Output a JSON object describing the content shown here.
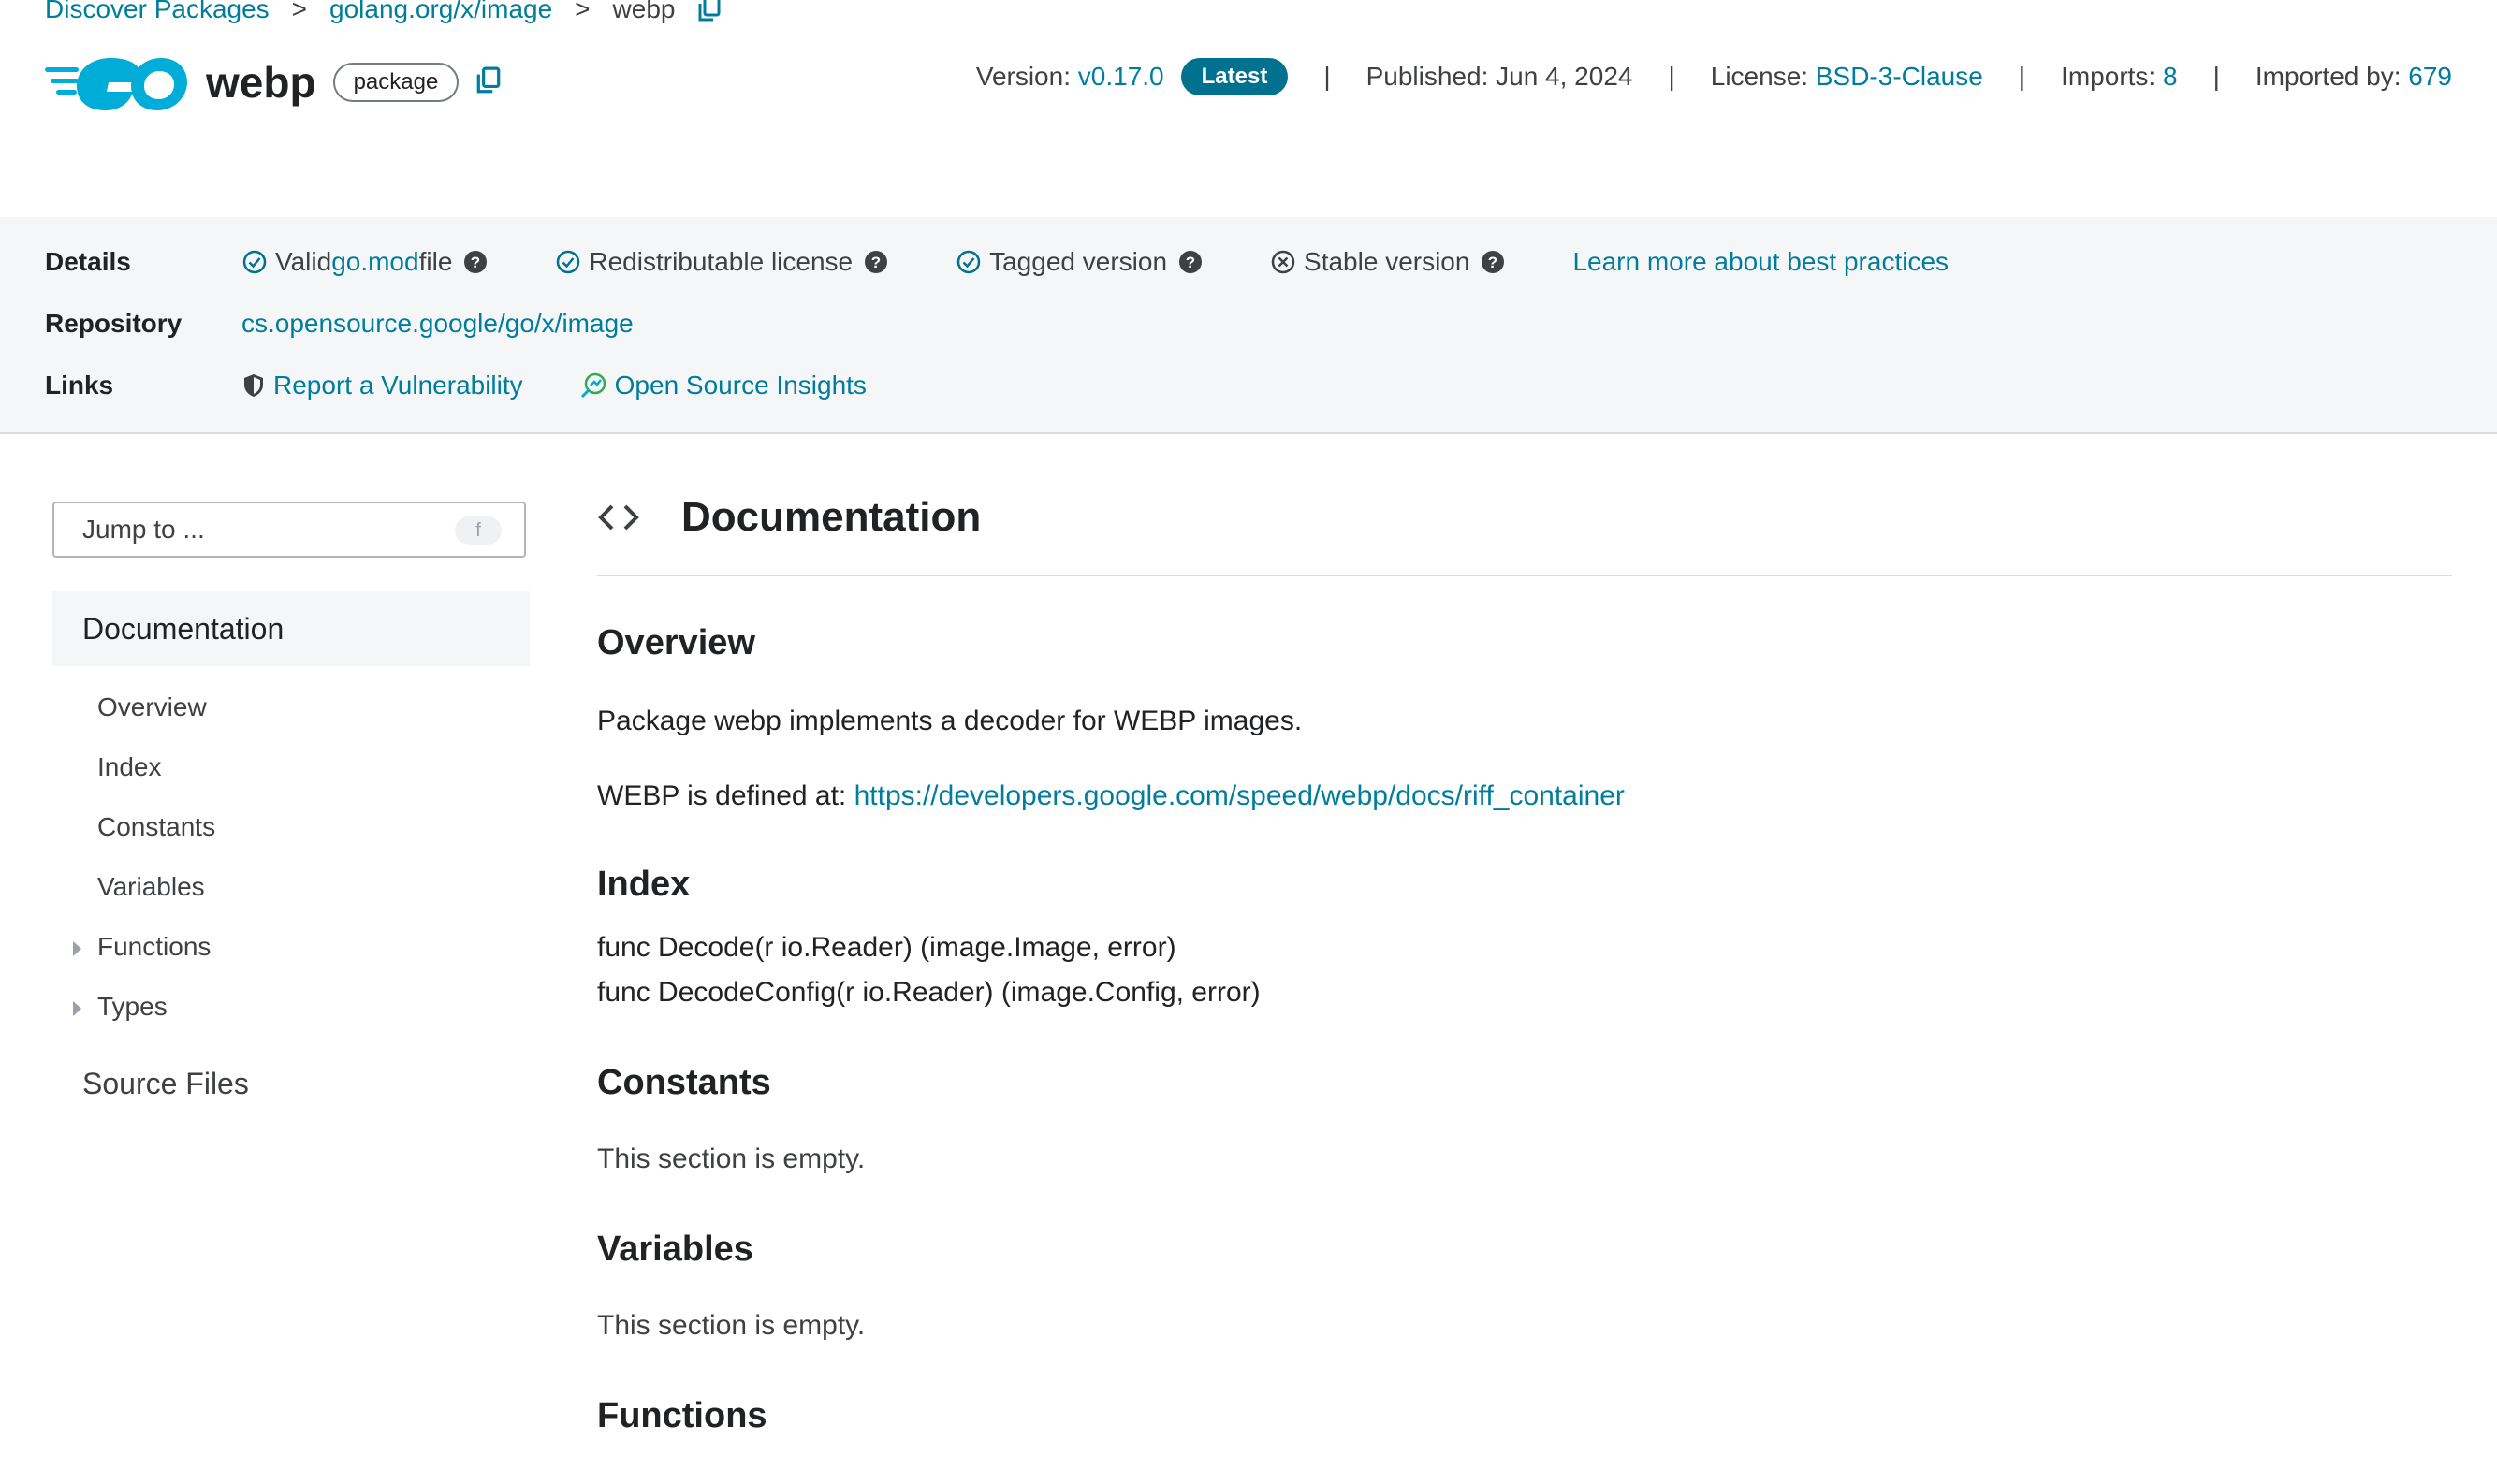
{
  "breadcrumb": {
    "items": [
      "Discover Packages",
      "golang.org/x/image",
      "webp"
    ],
    "separator": ">"
  },
  "header": {
    "logo": "go-logo",
    "title": "webp",
    "badge": "package",
    "version_label": "Version:",
    "version_value": "v0.17.0",
    "latest_label": "Latest",
    "published": "Published: Jun 4, 2024",
    "license_label": "License:",
    "license_value": "BSD-3-Clause",
    "imports_label": "Imports:",
    "imports_value": "8",
    "imported_by_label": "Imported by:",
    "imported_by_value": "679",
    "divider": "|"
  },
  "details": {
    "details_label": "Details",
    "checks": [
      {
        "pre": "Valid ",
        "link": "go.mod",
        "post": " file",
        "status": "valid"
      },
      {
        "pre": "Redistributable license",
        "status": "valid"
      },
      {
        "pre": "Tagged version",
        "status": "valid"
      },
      {
        "pre": "Stable version",
        "status": "invalid"
      }
    ],
    "learn_more": "Learn more about best practices",
    "repository_label": "Repository",
    "repository_value": "cs.opensource.google/go/x/image",
    "links_label": "Links",
    "link_vuln": "Report a Vulnerability",
    "link_insights": "Open Source Insights"
  },
  "sidebar": {
    "jump_placeholder": "Jump to ...",
    "jump_key": "f",
    "documentation": "Documentation",
    "items": [
      "Overview",
      "Index",
      "Constants",
      "Variables",
      "Functions",
      "Types"
    ],
    "source_files": "Source Files"
  },
  "main": {
    "heading": "Documentation",
    "overview_title": "Overview",
    "overview_text": "Package webp implements a decoder for WEBP images.",
    "defined_prefix": "WEBP is defined at: ",
    "defined_link": "https://developers.google.com/speed/webp/docs/riff_container",
    "index_title": "Index",
    "index_items": [
      "func Decode(r io.Reader) (image.Image, error)",
      "func DecodeConfig(r io.Reader) (image.Config, error)"
    ],
    "constants_title": "Constants",
    "constants_text": "This section is empty.",
    "variables_title": "Variables",
    "variables_text": "This section is empty.",
    "functions_title": "Functions"
  },
  "colors": {
    "link": "#007d9c",
    "badge_latest": "#00728f",
    "band": "#f5f6f7"
  }
}
